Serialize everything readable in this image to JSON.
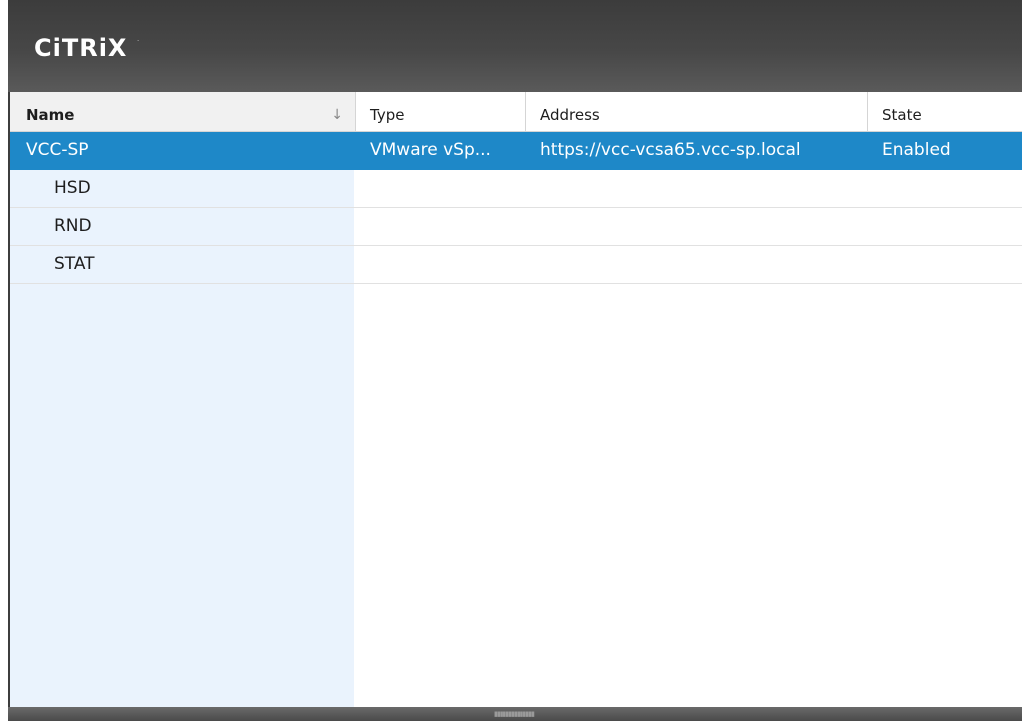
{
  "brand": {
    "logo_text": "CiTRiX",
    "trademark": "·"
  },
  "table": {
    "columns": [
      {
        "label": "Name",
        "sort": "descending"
      },
      {
        "label": "Type"
      },
      {
        "label": "Address"
      },
      {
        "label": "State"
      }
    ],
    "rows": [
      {
        "name": "VCC-SP",
        "type": "VMware vSp...",
        "address": "https://vcc-vcsa65.vcc-sp.local",
        "state": "Enabled",
        "selected": true,
        "level": 0
      },
      {
        "name": "HSD",
        "type": "",
        "address": "",
        "state": "",
        "selected": false,
        "level": 1
      },
      {
        "name": "RND",
        "type": "",
        "address": "",
        "state": "",
        "selected": false,
        "level": 1
      },
      {
        "name": "STAT",
        "type": "",
        "address": "",
        "state": "",
        "selected": false,
        "level": 1
      }
    ]
  },
  "icons": {
    "sort": "sort-descending-arrow-icon",
    "grip": "resize-grip-icon"
  },
  "colors": {
    "header_bg": "#474747",
    "selection": "#1e88c8",
    "name_column_bg": "#eaf3fd"
  }
}
